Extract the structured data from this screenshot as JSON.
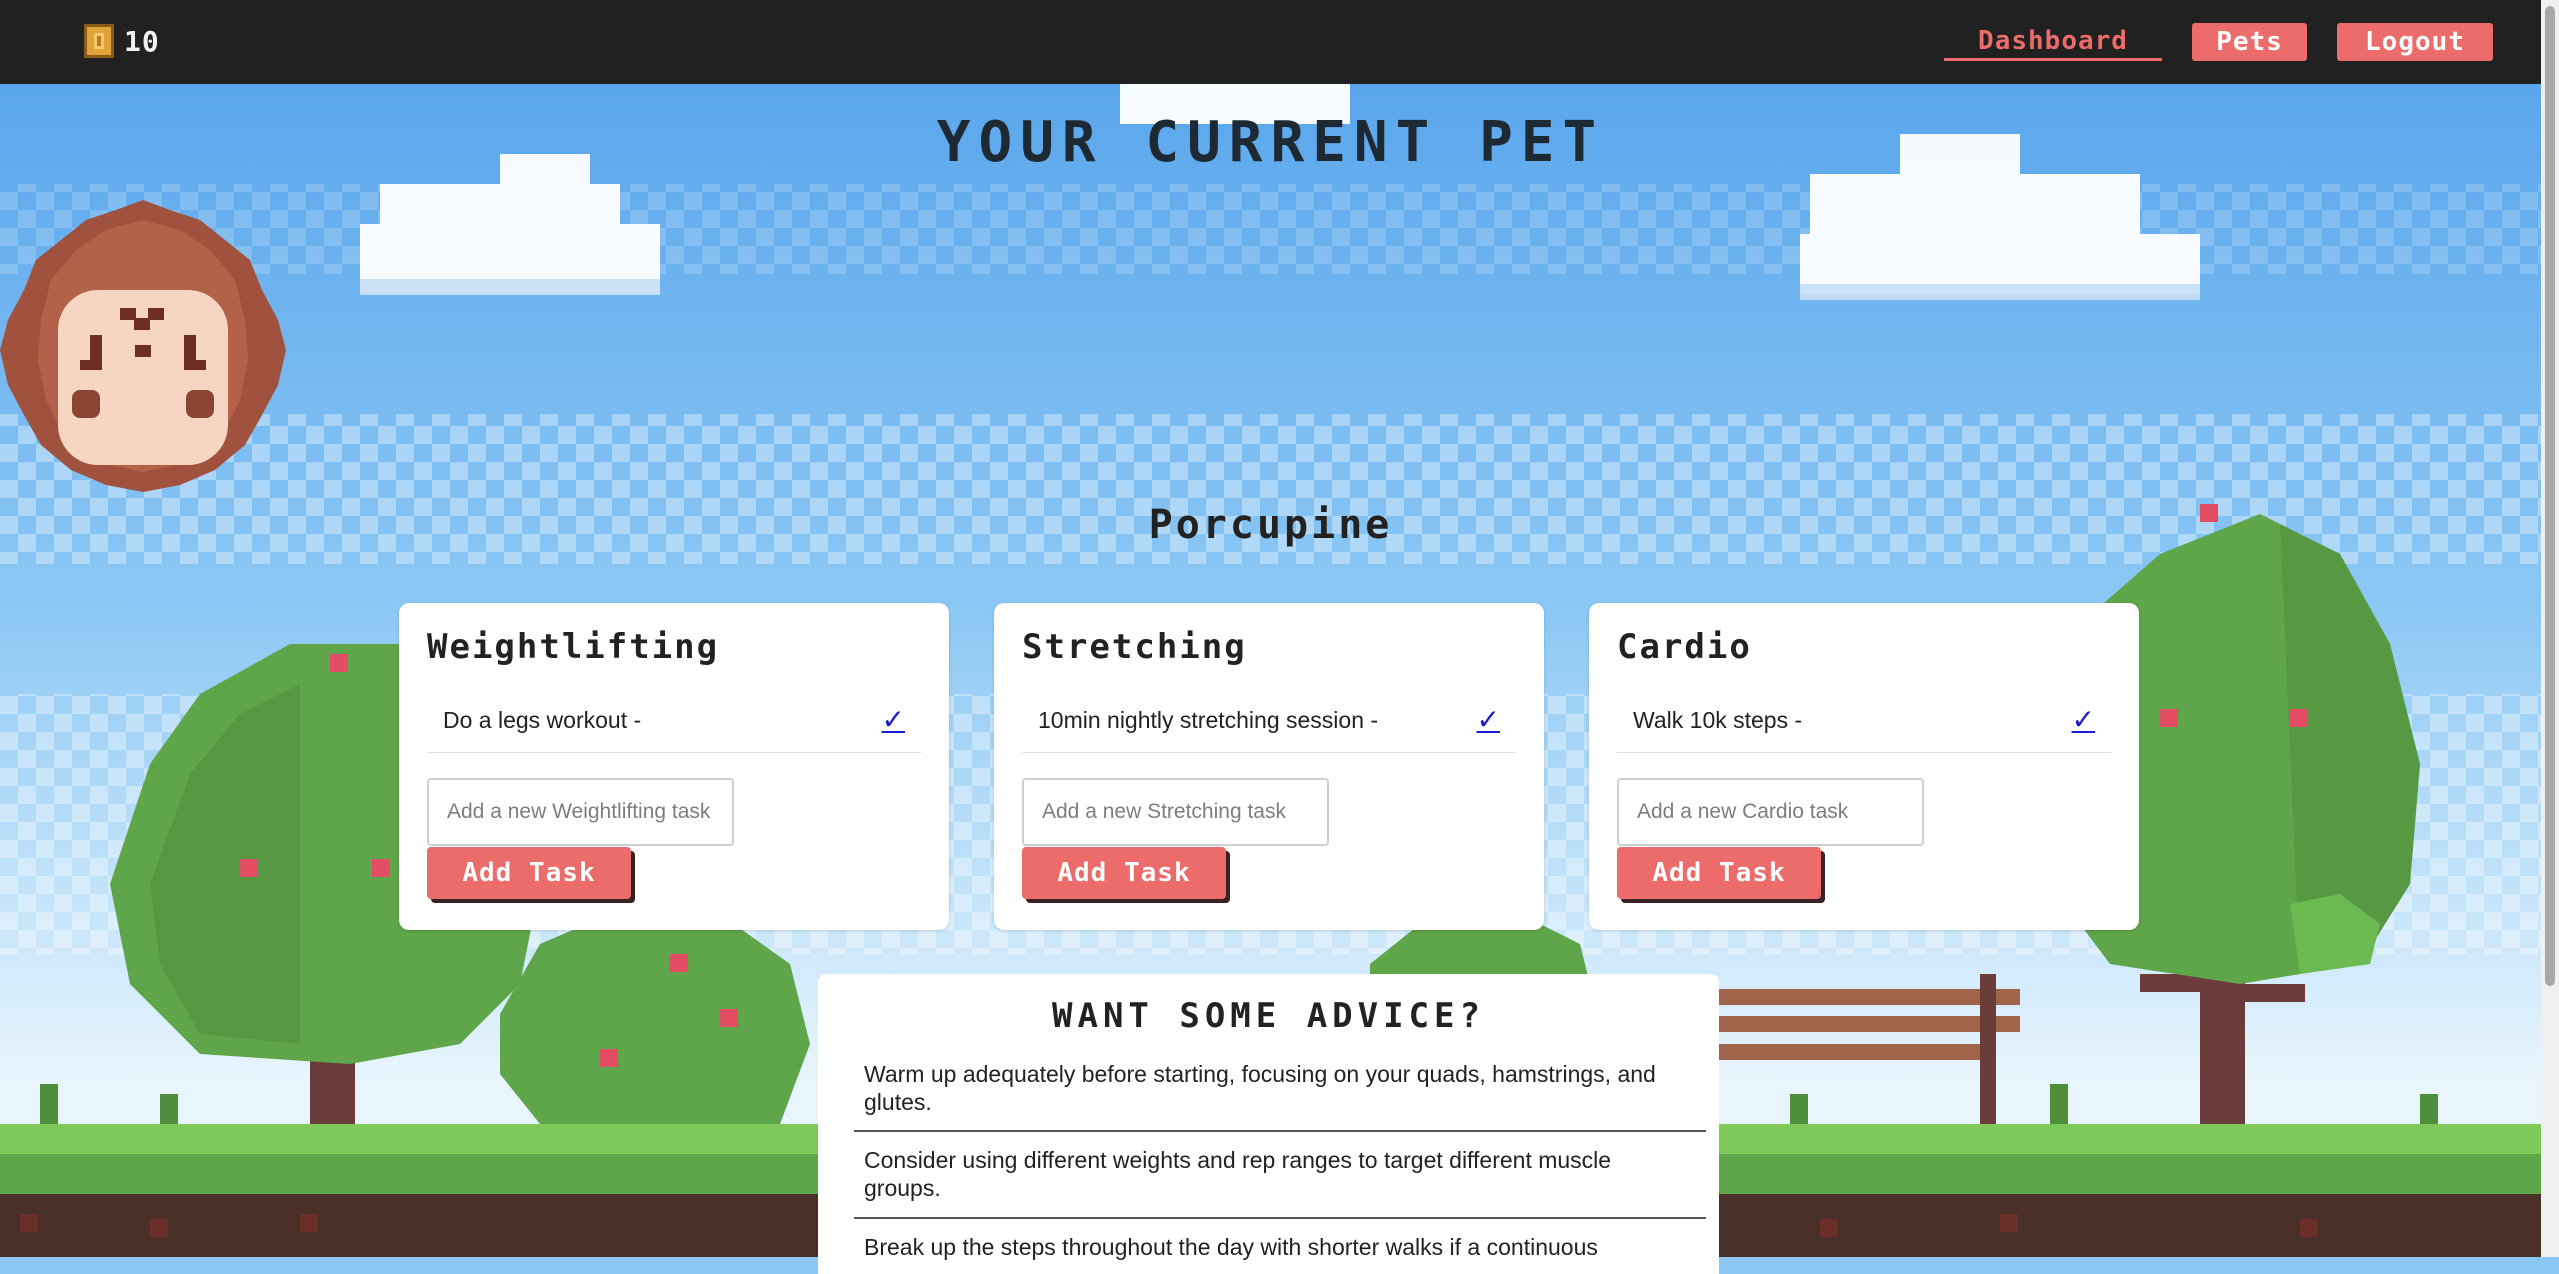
{
  "nav": {
    "coins": "10",
    "coin_icon": "coin-icon",
    "links": {
      "dashboard": "Dashboard",
      "pets": "Pets",
      "logout": "Logout"
    }
  },
  "pet": {
    "heading": "YOUR CURRENT PET",
    "name": "Porcupine"
  },
  "categories": [
    {
      "title": "Weightlifting",
      "tasks": [
        {
          "text": "Do a legs workout -",
          "check": "✓"
        }
      ],
      "input_placeholder": "Add a new Weightlifting task",
      "add_label": "Add Task"
    },
    {
      "title": "Stretching",
      "tasks": [
        {
          "text": "10min nightly stretching session -",
          "check": "✓"
        }
      ],
      "input_placeholder": "Add a new Stretching task",
      "add_label": "Add Task"
    },
    {
      "title": "Cardio",
      "tasks": [
        {
          "text": "Walk 10k steps -",
          "check": "✓"
        }
      ],
      "input_placeholder": "Add a new Cardio task",
      "add_label": "Add Task"
    }
  ],
  "advice": {
    "title": "WANT SOME ADVICE?",
    "items": [
      "Warm up adequately before starting, focusing on your quads, hamstrings, and glutes.",
      "Consider using different weights and rep ranges to target different muscle groups.",
      "Break up the steps throughout the day with shorter walks if a continuous"
    ]
  },
  "colors": {
    "accent": "#ec6b6b",
    "nav_bg": "#212121",
    "check": "#1a1ad4"
  }
}
